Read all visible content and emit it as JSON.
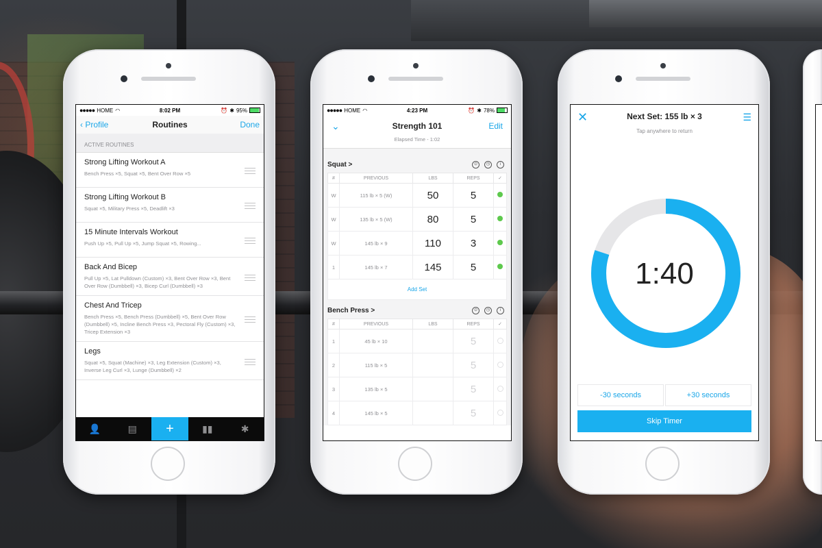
{
  "phone1": {
    "status": {
      "carrier": "HOME",
      "time": "8:02 PM",
      "battery": "95%",
      "battery_level": 0.95
    },
    "nav": {
      "back": "Profile",
      "title": "Routines",
      "done": "Done"
    },
    "section_label": "ACTIVE ROUTINES",
    "routines": [
      {
        "name": "Strong Lifting Workout A",
        "desc": "Bench Press ×5, Squat ×5, Bent Over Row ×5"
      },
      {
        "name": "Strong Lifting Workout B",
        "desc": "Squat ×5, Military Press ×5, Deadlift ×3"
      },
      {
        "name": "15 Minute Intervals Workout",
        "desc": "Push Up ×5, Pull Up ×5, Jump Squat ×5, Rowing..."
      },
      {
        "name": "Back And Bicep",
        "desc": "Pull Up ×5, Lat Pulldown (Custom) ×3, Bent Over Row ×3, Bent Over Row (Dumbbell) ×3, Bicep Curl (Dumbbell) ×3"
      },
      {
        "name": "Chest And Tricep",
        "desc": "Bench Press ×5, Bench Press (Dumbbell) ×5, Bent Over Row (Dumbbell) ×5, Incline Bench Press ×3, Pectoral Fly (Custom) ×3, Tricep Extension ×3"
      },
      {
        "name": "Legs",
        "desc": "Squat ×5, Squat (Machine) ×3, Leg Extension (Custom) ×3, Inverse Leg Curl ×3, Lunge (Dumbbell) ×2"
      }
    ],
    "tabs": [
      {
        "icon": "profile-icon",
        "glyph": "👤"
      },
      {
        "icon": "history-icon",
        "glyph": "▤"
      },
      {
        "icon": "plus-icon",
        "glyph": "+"
      },
      {
        "icon": "chart-icon",
        "glyph": "▮▮"
      },
      {
        "icon": "gear-icon",
        "glyph": "✱"
      }
    ]
  },
  "phone2": {
    "status": {
      "carrier": "HOME",
      "time": "4:23 PM",
      "battery": "78%",
      "battery_level": 0.78
    },
    "nav": {
      "title": "Strength 101",
      "edit": "Edit"
    },
    "elapsed": "Elapsed Time - 1:02",
    "columns": {
      "num": "#",
      "previous": "PREVIOUS",
      "lbs": "LBS",
      "reps": "REPS",
      "check": "✓"
    },
    "exercises": [
      {
        "name": "Squat >",
        "sets": [
          {
            "num": "W",
            "previous": "115 lb × 5 (W)",
            "lbs": "50",
            "reps": "5",
            "done": true
          },
          {
            "num": "W",
            "previous": "135 lb × 5 (W)",
            "lbs": "80",
            "reps": "5",
            "done": true
          },
          {
            "num": "W",
            "previous": "145 lb × 9",
            "lbs": "110",
            "reps": "3",
            "done": true
          },
          {
            "num": "1",
            "previous": "145 lb × 7",
            "lbs": "145",
            "reps": "5",
            "done": true
          }
        ],
        "add_set": "Add Set"
      },
      {
        "name": "Bench Press >",
        "sets": [
          {
            "num": "1",
            "previous": "45 lb × 10",
            "lbs": "",
            "reps": "5",
            "done": false
          },
          {
            "num": "2",
            "previous": "115 lb × 5",
            "lbs": "",
            "reps": "5",
            "done": false
          },
          {
            "num": "3",
            "previous": "135 lb × 5",
            "lbs": "",
            "reps": "5",
            "done": false
          },
          {
            "num": "4",
            "previous": "145 lb × 5",
            "lbs": "",
            "reps": "5",
            "done": false
          }
        ]
      }
    ]
  },
  "phone3": {
    "title": "Next Set: 155 lb × 3",
    "subtitle": "Tap anywhere to return",
    "timer": "1:40",
    "progress": 0.8,
    "minus": "-30 seconds",
    "plus": "+30 seconds",
    "skip": "Skip Timer"
  },
  "colors": {
    "accent": "#1ab0f0",
    "check": "#5ec94d",
    "ring_track": "#e6e6e8"
  }
}
